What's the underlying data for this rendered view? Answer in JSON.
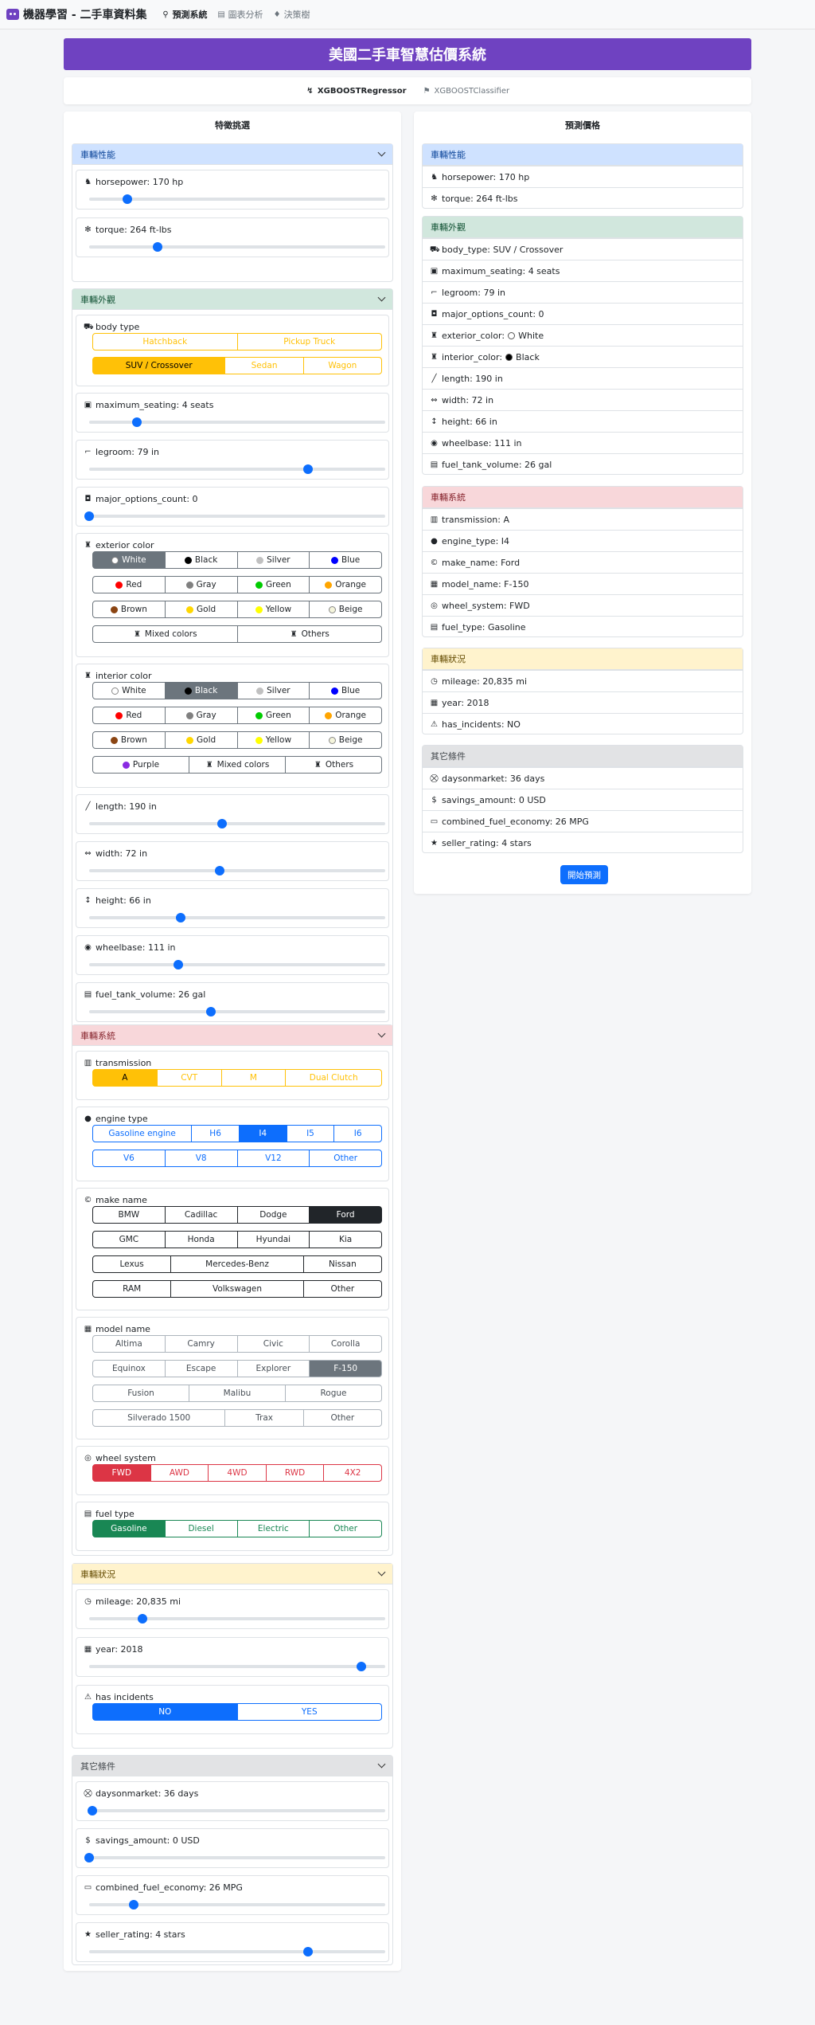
{
  "nav": {
    "brand": "機器學習 - 二手車資料集",
    "links": [
      "預測系統",
      "圖表分析",
      "決策樹"
    ]
  },
  "title": "美國二手車智慧估價系統",
  "models": [
    "XGBOOSTRegressor",
    "XGBOOSTClassifier"
  ],
  "left_title": "特徵挑選",
  "right_title": "預測價格",
  "colors": {
    "perf": "#cfe2ff",
    "perf_text": "#084298",
    "look": "#d1e7dd",
    "look_text": "#0f5132",
    "sys": "#f8d7da",
    "sys_text": "#842029",
    "status": "#fff3cd",
    "status_text": "#664d03",
    "other": "#e2e3e5",
    "other_text": "#41464b"
  },
  "sections": {
    "perf": "車輛性能",
    "look": "車輛外觀",
    "sys": "車輛系統",
    "status": "車輛狀況",
    "other": "其它條件"
  },
  "features": {
    "horsepower": {
      "label": "horsepower: 170 hp",
      "level": 0.13
    },
    "torque": {
      "label": "torque: 264 ft-lbs",
      "level": 0.23
    },
    "body_type": {
      "label": "body type",
      "row1": [
        "Hatchback",
        "Pickup Truck"
      ],
      "row2": [
        "SUV / Crossover",
        "Sedan",
        "Wagon"
      ]
    },
    "maximum_seating": {
      "label": "maximum_seating: 4 seats",
      "level": 0.16
    },
    "legroom": {
      "label": "legroom: 79 in",
      "level": 0.74
    },
    "major_options_count": {
      "label": "major_options_count: 0",
      "level": 0.0
    },
    "exterior_color": {
      "label": "exterior color",
      "rows": [
        [
          "White",
          "Black",
          "Silver",
          "Blue"
        ],
        [
          "Red",
          "Gray",
          "Green",
          "Orange"
        ],
        [
          "Brown",
          "Gold",
          "Yellow",
          "Beige"
        ],
        [
          "Mixed colors",
          "Others"
        ]
      ]
    },
    "interior_color": {
      "label": "interior color",
      "rows": [
        [
          "White",
          "Black",
          "Silver",
          "Blue"
        ],
        [
          "Red",
          "Gray",
          "Green",
          "Orange"
        ],
        [
          "Brown",
          "Gold",
          "Yellow",
          "Beige"
        ],
        [
          "Purple",
          "Mixed colors",
          "Others"
        ]
      ]
    },
    "length": {
      "label": "length: 190 in",
      "level": 0.45
    },
    "width": {
      "label": "width: 72 in",
      "level": 0.44
    },
    "height": {
      "label": "height: 66 in",
      "level": 0.31
    },
    "wheelbase": {
      "label": "wheelbase: 111 in",
      "level": 0.3
    },
    "fuel_tank_volume": {
      "label": "fuel_tank_volume: 26 gal",
      "level": 0.41
    },
    "transmission": {
      "label": "transmission",
      "options": [
        "A",
        "CVT",
        "M",
        "Dual Clutch"
      ]
    },
    "engine_type": {
      "label": "engine type",
      "row1": [
        "Gasoline engine",
        "H6",
        "I4",
        "I5",
        "I6"
      ],
      "row2": [
        "V6",
        "V8",
        "V12",
        "Other"
      ]
    },
    "make_name": {
      "label": "make name",
      "rows": [
        [
          "BMW",
          "Cadillac",
          "Dodge",
          "Ford"
        ],
        [
          "GMC",
          "Honda",
          "Hyundai",
          "Kia"
        ],
        [
          "Lexus",
          "Mercedes-Benz",
          "Nissan"
        ],
        [
          "RAM",
          "Volkswagen",
          "Other"
        ]
      ]
    },
    "model_name": {
      "label": "model name",
      "rows": [
        [
          "Altima",
          "Camry",
          "Civic",
          "Corolla"
        ],
        [
          "Equinox",
          "Escape",
          "Explorer",
          "F-150"
        ],
        [
          "Fusion",
          "Malibu",
          "Rogue"
        ],
        [
          "Silverado 1500",
          "Trax",
          "Other"
        ]
      ]
    },
    "wheel_system": {
      "label": "wheel system",
      "options": [
        "FWD",
        "AWD",
        "4WD",
        "RWD",
        "4X2"
      ]
    },
    "fuel_type": {
      "label": "fuel type",
      "options": [
        "Gasoline",
        "Diesel",
        "Electric",
        "Other"
      ]
    },
    "mileage": {
      "label": "mileage: 20,835 mi",
      "level": 0.18
    },
    "year": {
      "label": "year: 2018",
      "level": 0.92
    },
    "has_incidents": {
      "label": "has incidents",
      "options": [
        "NO",
        "YES"
      ]
    },
    "daysonmarket": {
      "label": "daysonmarket: 36 days",
      "level": 0.01
    },
    "savings_amount": {
      "label": "savings_amount: 0 USD",
      "level": 0.0
    },
    "combined_fuel_economy": {
      "label": "combined_fuel_economy: 26 MPG",
      "level": 0.15
    },
    "seller_rating": {
      "label": "seller_rating: 4 stars",
      "level": 0.74
    }
  },
  "summary": {
    "perf": [
      "horsepower: 170 hp",
      "torque: 264 ft-lbs"
    ],
    "look": [
      "body_type: SUV / Crossover",
      "maximum_seating: 4 seats",
      "legroom: 79 in",
      "major_options_count: 0",
      "exterior_color: ",
      "interior_color: ",
      "length: 190 in",
      "width: 72 in",
      "height: 66 in",
      "wheelbase: 111 in",
      "fuel_tank_volume: 26 gal"
    ],
    "look_colors": [
      "White",
      "Black"
    ],
    "sys": [
      "transmission: A",
      "engine_type: I4",
      "make_name: Ford",
      "model_name: F-150",
      "wheel_system: FWD",
      "fuel_type: Gasoline"
    ],
    "status": [
      "mileage: 20,835 mi",
      "year: 2018",
      "has_incidents: NO"
    ],
    "other": [
      "daysonmarket: 36 days",
      "savings_amount: 0 USD",
      "combined_fuel_economy: 26 MPG",
      "seller_rating: 4 stars"
    ]
  },
  "start_button": "開始預測"
}
